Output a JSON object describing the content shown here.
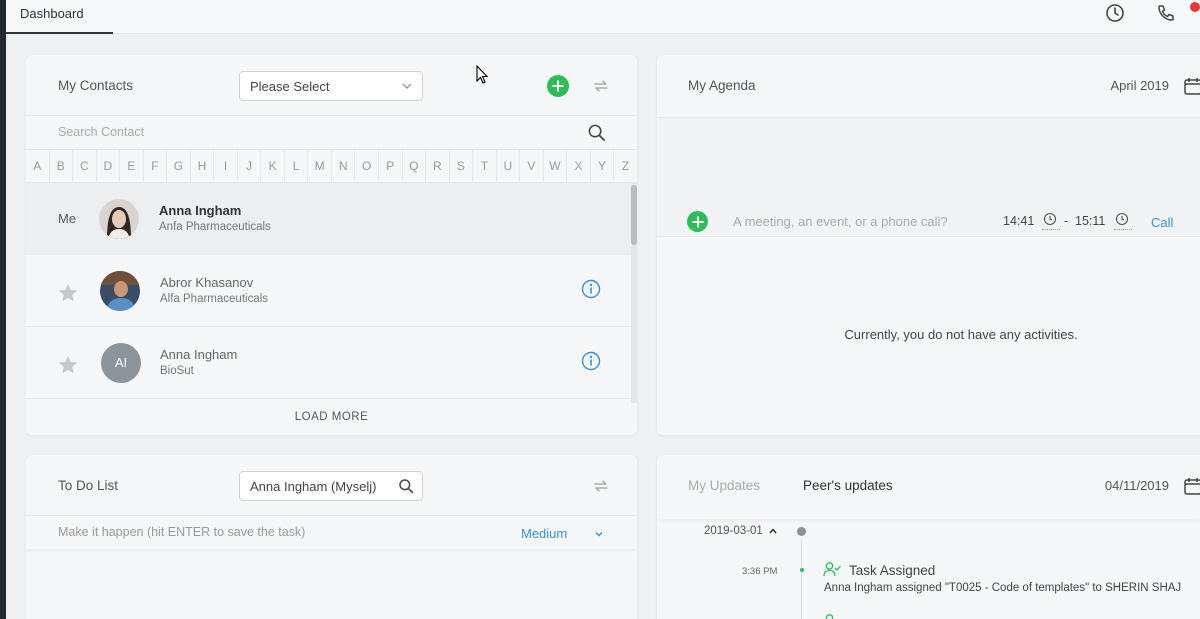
{
  "topbar": {
    "tab_dashboard": "Dashboard",
    "icons": [
      "clock-icon",
      "phone-icon"
    ],
    "badge_color": "#e53935"
  },
  "contacts": {
    "title": "My Contacts",
    "select_value": "Please Select",
    "search_placeholder": "Search Contact",
    "alphabet": [
      "A",
      "B",
      "C",
      "D",
      "E",
      "F",
      "G",
      "H",
      "I",
      "J",
      "K",
      "L",
      "M",
      "N",
      "O",
      "P",
      "Q",
      "R",
      "S",
      "T",
      "U",
      "V",
      "W",
      "X",
      "Y",
      "Z"
    ],
    "rows": [
      {
        "label": "Me",
        "name": "Anna Ingham",
        "company": "Anfa Pharmaceuticals",
        "avatar": "photo"
      },
      {
        "name": "Abror Khasanov",
        "company": "Alfa Pharmaceuticals",
        "avatar": "photo"
      },
      {
        "name": "Anna Ingham",
        "company": "BioSut",
        "avatar_initials": "AI"
      }
    ],
    "load_more": "LOAD MORE"
  },
  "agenda": {
    "title": "My Agenda",
    "month": "April 2019",
    "input_placeholder": "A meeting, an event, or a phone call?",
    "start_time": "14:41",
    "dash": "-",
    "end_time": "15:11",
    "type_link": "Call",
    "empty_message": "Currently, you do not have any activities."
  },
  "todo": {
    "title": "To Do List",
    "assignee": "Anna Ingham (Myselj)",
    "input_placeholder": "Make it happen (hit ENTER to save the task)",
    "priority": "Medium"
  },
  "updates": {
    "tab_my": "My Updates",
    "tab_peers": "Peer's updates",
    "date": "04/11/2019",
    "group_date": "2019-03-01",
    "item_time": "3:36 PM",
    "item_title": "Task Assigned",
    "item_desc": "Anna Ingham assigned \"T0025 - Code of templates\" to SHERIN SHAJ"
  },
  "colors": {
    "accent_green": "#2ebd59",
    "link_blue": "#3b8fd6",
    "dark_strip": "#23272e"
  }
}
